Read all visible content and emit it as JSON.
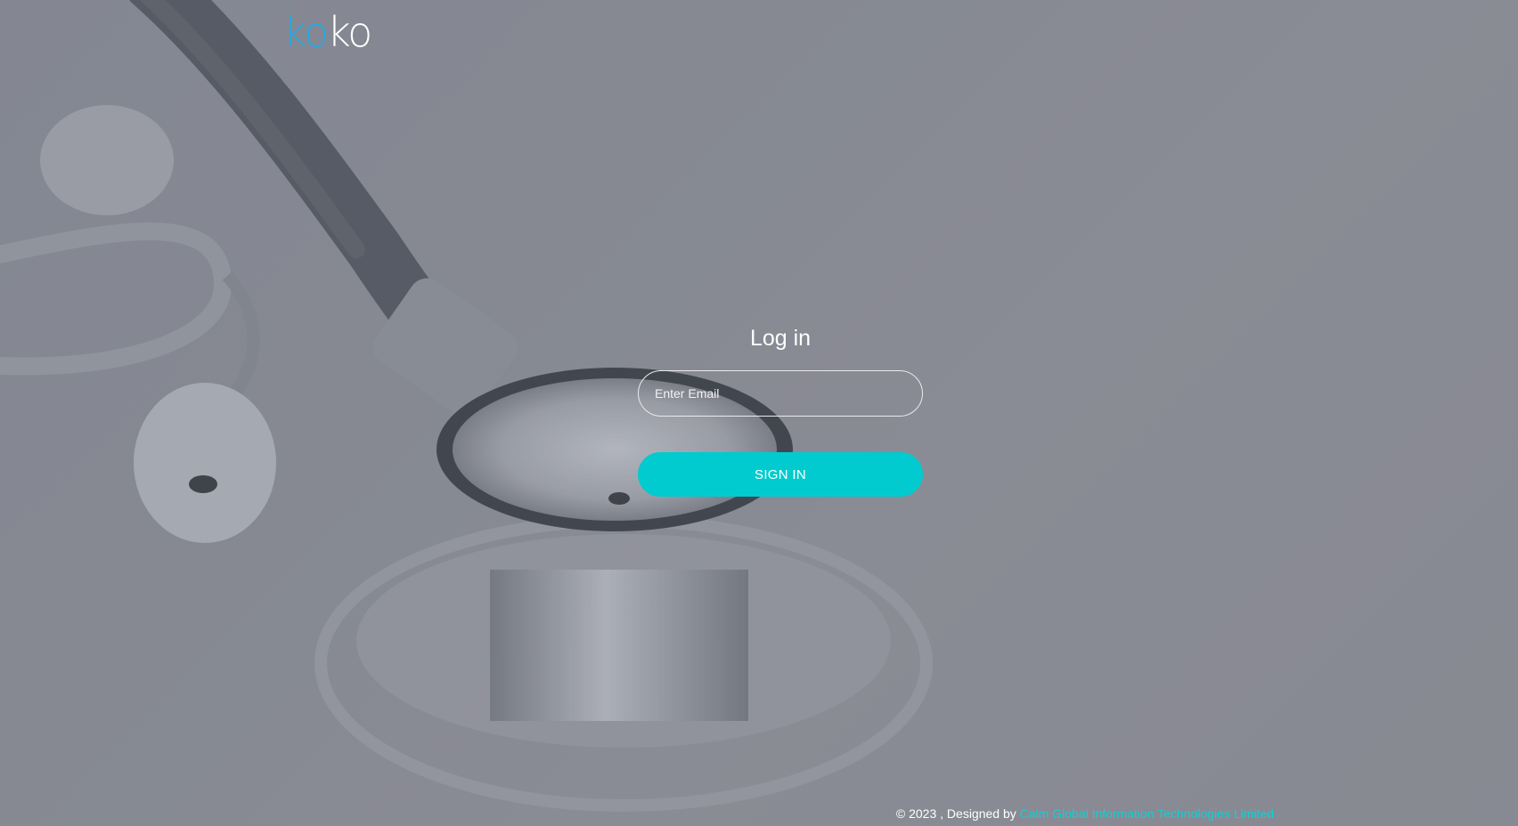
{
  "logo": {
    "part1": "ko",
    "part2": "ko"
  },
  "login": {
    "title": "Log in",
    "email_placeholder": "Enter Email",
    "signin_label": "SIGN IN"
  },
  "footer": {
    "copyright": "© 2023 , Designed by",
    "company_link": "Calm Global Information Technologies Limited"
  },
  "colors": {
    "accent": "#01cbce",
    "logo_blue": "#2aa6e0",
    "link": "#0fd0d6"
  },
  "background": {
    "image_subject": "stethoscope-photo"
  }
}
